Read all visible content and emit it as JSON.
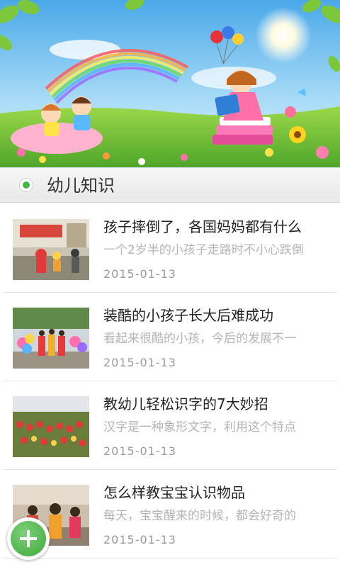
{
  "section": {
    "title": "幼儿知识"
  },
  "articles": [
    {
      "title": "孩子摔倒了，各国妈妈都有什么",
      "summary": "一个2岁半的小孩子走路时不小心跌倒",
      "date": "2015-01-13"
    },
    {
      "title": "装酷的小孩子长大后难成功",
      "summary": "看起来很酷的小孩，今后的发展不一",
      "date": "2015-01-13"
    },
    {
      "title": "教幼儿轻松识字的7大妙招",
      "summary": "汉字是一种象形文字，利用这个特点",
      "date": "2015-01-13"
    },
    {
      "title": "怎么样教宝宝认识物品",
      "summary": "每天，宝宝醒来的时候，都会好奇的",
      "date": "2015-01-13"
    }
  ],
  "icons": {
    "section_marker": "radio-dot-icon",
    "fab": "plus-icon"
  },
  "colors": {
    "accent_green": "#3fb944",
    "title_text": "#222222",
    "summary_text": "#b4b4b4",
    "date_text": "#9a9a9a"
  }
}
